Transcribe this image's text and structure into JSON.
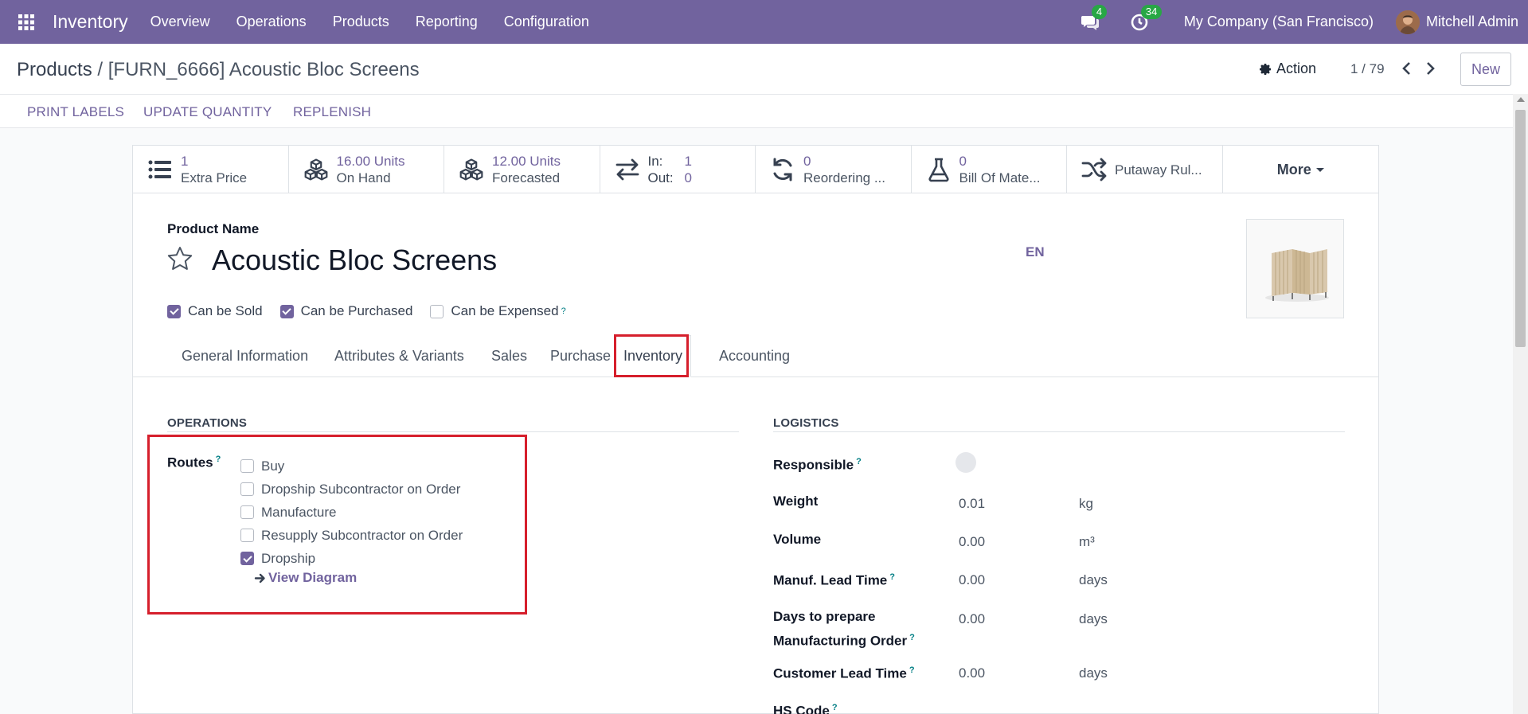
{
  "navbar": {
    "app_name": "Inventory",
    "menu": [
      "Overview",
      "Operations",
      "Products",
      "Reporting",
      "Configuration"
    ],
    "messages_badge": "4",
    "activities_badge": "34",
    "company": "My Company (San Francisco)",
    "user": "Mitchell Admin",
    "accent_color": "#71639e"
  },
  "control": {
    "breadcrumb_parent": "Products",
    "breadcrumb_separator": "/",
    "breadcrumb_current": "[FURN_6666] Acoustic Bloc Screens",
    "action_label": "Action",
    "pager": "1 / 79",
    "new_label": "New"
  },
  "buttons": {
    "print_labels": "PRINT LABELS",
    "update_quantity": "UPDATE QUANTITY",
    "replenish": "REPLENISH"
  },
  "stats": {
    "extra_price": {
      "value": "1",
      "label": "Extra Price"
    },
    "on_hand": {
      "value": "16.00 Units",
      "label": "On Hand"
    },
    "forecasted": {
      "value": "12.00 Units",
      "label": "Forecasted"
    },
    "in_out": {
      "in_label": "In:",
      "in_value": "1",
      "out_label": "Out:",
      "out_value": "0"
    },
    "reordering": {
      "value": "0",
      "label": "Reordering ..."
    },
    "bom": {
      "value": "0",
      "label": "Bill Of Mate..."
    },
    "putaway": {
      "label": "Putaway Rul..."
    },
    "more": "More"
  },
  "product": {
    "name_label": "Product Name",
    "name": "Acoustic Bloc Screens",
    "lang": "EN",
    "can_be_sold": "Can be Sold",
    "can_be_purchased": "Can be Purchased",
    "can_be_expensed": "Can be Expensed",
    "help_mark": "?"
  },
  "tabs": [
    "General Information",
    "Attributes & Variants",
    "Sales",
    "Purchase",
    "Inventory",
    "Accounting"
  ],
  "operations": {
    "title": "OPERATIONS",
    "routes_label": "Routes",
    "routes": [
      {
        "label": "Buy",
        "checked": false
      },
      {
        "label": "Dropship Subcontractor on Order",
        "checked": false
      },
      {
        "label": "Manufacture",
        "checked": false
      },
      {
        "label": "Resupply Subcontractor on Order",
        "checked": false
      },
      {
        "label": "Dropship",
        "checked": true
      }
    ],
    "view_diagram": "View Diagram"
  },
  "logistics": {
    "title": "LOGISTICS",
    "responsible": "Responsible",
    "weight": {
      "label": "Weight",
      "value": "0.01",
      "unit": "kg"
    },
    "volume": {
      "label": "Volume",
      "value": "0.00",
      "unit": "m³"
    },
    "manuf_lead_time": {
      "label": "Manuf. Lead Time",
      "value": "0.00",
      "unit": "days"
    },
    "days_to_prepare": {
      "label_1": "Days to prepare",
      "label_2": "Manufacturing Order",
      "value": "0.00",
      "unit": "days"
    },
    "customer_lead_time": {
      "label": "Customer Lead Time",
      "value": "0.00",
      "unit": "days"
    },
    "hs_code": "HS Code"
  }
}
